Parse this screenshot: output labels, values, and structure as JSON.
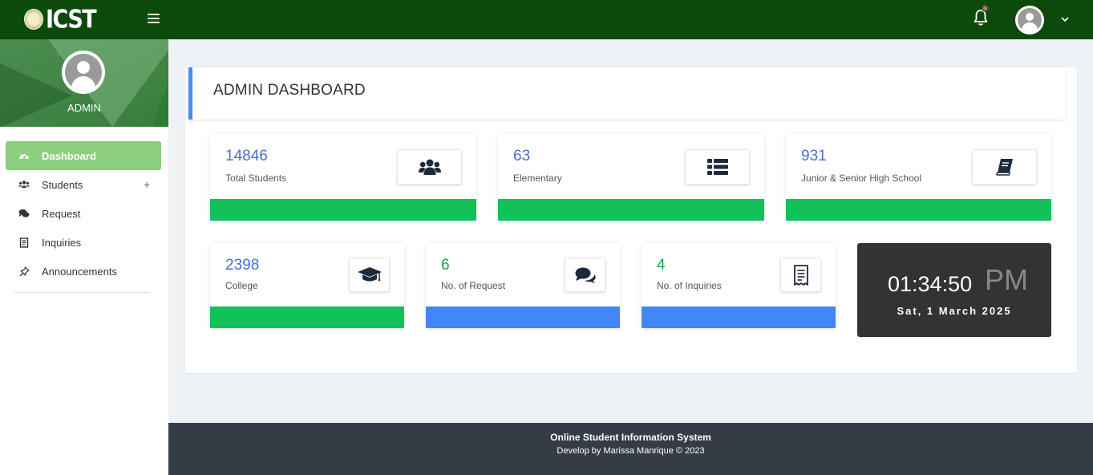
{
  "brand": {
    "name": "ICST"
  },
  "colors": {
    "navbar": "#0b4a0b",
    "sidebar_active": "#8ccf7e",
    "green_bar": "#13c15a",
    "blue_bar": "#4287f5",
    "number_blue": "#4a6fd8",
    "number_green": "#13a84a",
    "clock_bg": "#333333",
    "footer_bg": "#343d46"
  },
  "topbar": {
    "menu_icon": "hamburger-icon",
    "notification_icon": "bell-icon",
    "user_icon": "user-avatar-icon",
    "dropdown_icon": "chevron-down-icon"
  },
  "sidebar": {
    "role": "ADMIN",
    "items": [
      {
        "label": "Dashboard",
        "icon": "gauge-icon",
        "active": true
      },
      {
        "label": "Students",
        "icon": "users-icon",
        "expand": "+"
      },
      {
        "label": "Request",
        "icon": "comments-icon"
      },
      {
        "label": "Inquiries",
        "icon": "receipt-icon"
      },
      {
        "label": "Announcements",
        "icon": "pin-icon"
      }
    ]
  },
  "main": {
    "title": "ADMIN DASHBOARD",
    "stats": [
      {
        "value": "14846",
        "label": "Total Students",
        "icon": "users-icon",
        "bar": "green"
      },
      {
        "value": "63",
        "label": "Elementary",
        "icon": "list-icon",
        "bar": "green"
      },
      {
        "value": "931",
        "label": "Junior & Senior High School",
        "icon": "book-icon",
        "bar": "green"
      },
      {
        "value": "2398",
        "label": "College",
        "icon": "graduation-cap-icon",
        "bar": "green"
      },
      {
        "value": "6",
        "label": "No. of Request",
        "icon": "comments-icon",
        "bar": "blue"
      },
      {
        "value": "4",
        "label": "No. of Inquiries",
        "icon": "receipt-icon",
        "bar": "blue"
      }
    ],
    "clock": {
      "time": "01:34:50",
      "ampm": "PM",
      "date": "Sat, 1 March 2025"
    }
  },
  "footer": {
    "line1": "Online Student Information System",
    "line2": "Develop by Marissa Manrique © 2023"
  }
}
